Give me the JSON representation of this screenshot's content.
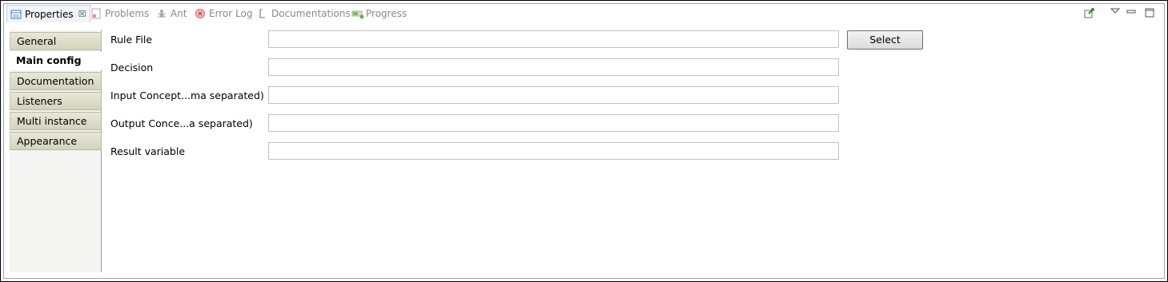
{
  "tabs": [
    {
      "label": "Properties",
      "icon": "properties-icon",
      "active": true
    },
    {
      "label": "Problems",
      "icon": "problems-icon"
    },
    {
      "label": "Ant",
      "icon": "ant-icon"
    },
    {
      "label": "Error Log",
      "icon": "error-log-icon"
    },
    {
      "label": "Documentations",
      "icon": "documentations-icon"
    },
    {
      "label": "Progress",
      "icon": "progress-icon"
    }
  ],
  "close_glyph": "☒",
  "sections": [
    {
      "label": "General"
    },
    {
      "label": "Main config",
      "active": true
    },
    {
      "label": "Documentation"
    },
    {
      "label": "Listeners"
    },
    {
      "label": "Multi instance"
    },
    {
      "label": "Appearance"
    }
  ],
  "form": {
    "rule_file_label": "Rule File",
    "rule_file_value": "",
    "select_label": "Select",
    "decision_label": "Decision",
    "decision_value": "",
    "input_concepts_label": "Input Concept...ma separated)",
    "input_concepts_value": "",
    "output_concepts_label": "Output Conce...a separated)",
    "output_concepts_value": "",
    "result_variable_label": "Result variable",
    "result_variable_value": ""
  },
  "colors": {
    "accent": "#3c78c8",
    "section_bg": "#d9d9c4"
  }
}
